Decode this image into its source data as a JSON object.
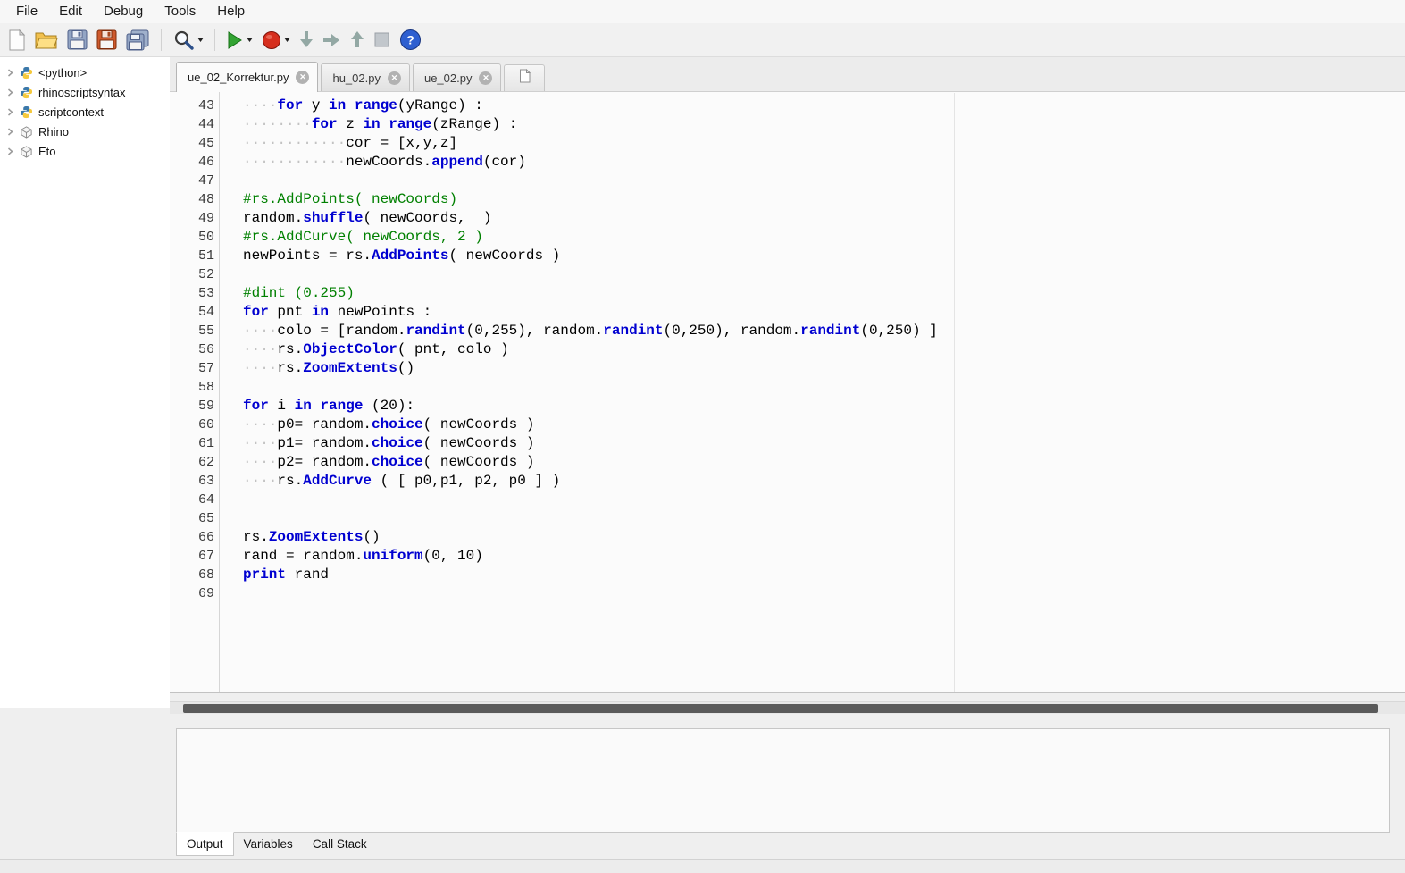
{
  "menu": {
    "items": [
      {
        "label": "File"
      },
      {
        "label": "Edit"
      },
      {
        "label": "Debug"
      },
      {
        "label": "Tools"
      },
      {
        "label": "Help"
      }
    ]
  },
  "toolbar": {
    "buttons": [
      {
        "name": "new-file",
        "icon": "new-file"
      },
      {
        "name": "open-file",
        "icon": "open-folder"
      },
      {
        "name": "save-file",
        "icon": "floppy"
      },
      {
        "name": "save-as",
        "icon": "floppy-red"
      },
      {
        "name": "save-all",
        "icon": "floppy-all"
      },
      {
        "name": "separator"
      },
      {
        "name": "search",
        "icon": "magnifier",
        "dropdown": true
      },
      {
        "name": "separator"
      },
      {
        "name": "run-script",
        "icon": "play",
        "dropdown": true
      },
      {
        "name": "stop-script",
        "icon": "record",
        "dropdown": true
      },
      {
        "name": "step-into",
        "icon": "arrow-down"
      },
      {
        "name": "step-over",
        "icon": "arrow-right"
      },
      {
        "name": "step-out",
        "icon": "arrow-up"
      },
      {
        "name": "pause",
        "icon": "square"
      },
      {
        "name": "help",
        "icon": "help"
      }
    ]
  },
  "sidebar": {
    "items": [
      {
        "label": "<python>",
        "icon": "python"
      },
      {
        "label": "rhinoscriptsyntax",
        "icon": "python"
      },
      {
        "label": "scriptcontext",
        "icon": "python"
      },
      {
        "label": "Rhino",
        "icon": "box"
      },
      {
        "label": "Eto",
        "icon": "box"
      }
    ]
  },
  "tabs": {
    "items": [
      {
        "label": "ue_02_Korrektur.py",
        "active": true,
        "closable": true
      },
      {
        "label": "hu_02.py",
        "active": false,
        "closable": true
      },
      {
        "label": "ue_02.py",
        "active": false,
        "closable": true
      }
    ]
  },
  "editor": {
    "syntax_colors": {
      "keyword": "#0000d0",
      "comment": "#008000",
      "whitespace_dots": "#c2c2c2",
      "text": "#000000"
    },
    "lines": [
      {
        "n": "43",
        "s": [
          [
            "ws",
            "····"
          ],
          [
            "kw",
            "for"
          ],
          [
            "tx",
            " y "
          ],
          [
            "kw",
            "in"
          ],
          [
            "tx",
            " "
          ],
          [
            "kw",
            "range"
          ],
          [
            "tx",
            "(yRange) :"
          ]
        ]
      },
      {
        "n": "44",
        "s": [
          [
            "ws",
            "········"
          ],
          [
            "kw",
            "for"
          ],
          [
            "tx",
            " z "
          ],
          [
            "kw",
            "in"
          ],
          [
            "tx",
            " "
          ],
          [
            "kw",
            "range"
          ],
          [
            "tx",
            "(zRange) :"
          ]
        ]
      },
      {
        "n": "45",
        "s": [
          [
            "ws",
            "············"
          ],
          [
            "tx",
            "cor = [x,y,z]"
          ]
        ]
      },
      {
        "n": "46",
        "s": [
          [
            "ws",
            "············"
          ],
          [
            "tx",
            "newCoords."
          ],
          [
            "kw",
            "append"
          ],
          [
            "tx",
            "(cor)"
          ]
        ]
      },
      {
        "n": "47",
        "s": []
      },
      {
        "n": "48",
        "s": [
          [
            "cm",
            "#rs.AddPoints( newCoords)"
          ]
        ]
      },
      {
        "n": "49",
        "s": [
          [
            "tx",
            "random."
          ],
          [
            "kw",
            "shuffle"
          ],
          [
            "tx",
            "( newCoords,  )"
          ]
        ]
      },
      {
        "n": "50",
        "s": [
          [
            "cm",
            "#rs.AddCurve( newCoords, 2 )"
          ]
        ]
      },
      {
        "n": "51",
        "s": [
          [
            "tx",
            "newPoints = rs."
          ],
          [
            "kw",
            "AddPoints"
          ],
          [
            "tx",
            "( newCoords )"
          ]
        ]
      },
      {
        "n": "52",
        "s": []
      },
      {
        "n": "53",
        "s": [
          [
            "cm",
            "#dint (0.255)"
          ]
        ]
      },
      {
        "n": "54",
        "s": [
          [
            "kw",
            "for"
          ],
          [
            "tx",
            " pnt "
          ],
          [
            "kw",
            "in"
          ],
          [
            "tx",
            " newPoints :"
          ]
        ]
      },
      {
        "n": "55",
        "s": [
          [
            "ws",
            "····"
          ],
          [
            "tx",
            "colo = [random."
          ],
          [
            "kw",
            "randint"
          ],
          [
            "tx",
            "(0,255), random."
          ],
          [
            "kw",
            "randint"
          ],
          [
            "tx",
            "(0,250), random."
          ],
          [
            "kw",
            "randint"
          ],
          [
            "tx",
            "(0,250) ]"
          ]
        ]
      },
      {
        "n": "56",
        "s": [
          [
            "ws",
            "····"
          ],
          [
            "tx",
            "rs."
          ],
          [
            "kw",
            "ObjectColor"
          ],
          [
            "tx",
            "( pnt, colo )"
          ]
        ]
      },
      {
        "n": "57",
        "s": [
          [
            "ws",
            "····"
          ],
          [
            "tx",
            "rs."
          ],
          [
            "kw",
            "ZoomExtents"
          ],
          [
            "tx",
            "()"
          ]
        ]
      },
      {
        "n": "58",
        "s": []
      },
      {
        "n": "59",
        "s": [
          [
            "kw",
            "for"
          ],
          [
            "tx",
            " i "
          ],
          [
            "kw",
            "in"
          ],
          [
            "tx",
            " "
          ],
          [
            "kw",
            "range"
          ],
          [
            "tx",
            " (20):"
          ]
        ]
      },
      {
        "n": "60",
        "s": [
          [
            "ws",
            "····"
          ],
          [
            "tx",
            "p0= random."
          ],
          [
            "kw",
            "choice"
          ],
          [
            "tx",
            "( newCoords )"
          ]
        ]
      },
      {
        "n": "61",
        "s": [
          [
            "ws",
            "····"
          ],
          [
            "tx",
            "p1= random."
          ],
          [
            "kw",
            "choice"
          ],
          [
            "tx",
            "( newCoords )"
          ]
        ]
      },
      {
        "n": "62",
        "s": [
          [
            "ws",
            "····"
          ],
          [
            "tx",
            "p2= random."
          ],
          [
            "kw",
            "choice"
          ],
          [
            "tx",
            "( newCoords )"
          ]
        ]
      },
      {
        "n": "63",
        "s": [
          [
            "ws",
            "····"
          ],
          [
            "tx",
            "rs."
          ],
          [
            "kw",
            "AddCurve"
          ],
          [
            "tx",
            " ( [ p0,p1, p2, p0 ] )"
          ]
        ]
      },
      {
        "n": "64",
        "s": []
      },
      {
        "n": "65",
        "s": []
      },
      {
        "n": "66",
        "s": [
          [
            "tx",
            "rs."
          ],
          [
            "kw",
            "ZoomExtents"
          ],
          [
            "tx",
            "()"
          ]
        ]
      },
      {
        "n": "67",
        "s": [
          [
            "tx",
            "rand = random."
          ],
          [
            "kw",
            "uniform"
          ],
          [
            "tx",
            "(0, 10)"
          ]
        ]
      },
      {
        "n": "68",
        "s": [
          [
            "kw",
            "print"
          ],
          [
            "tx",
            " rand"
          ]
        ]
      },
      {
        "n": "69",
        "s": []
      }
    ]
  },
  "bottom_panel": {
    "tabs": [
      {
        "label": "Output",
        "active": true
      },
      {
        "label": "Variables",
        "active": false
      },
      {
        "label": "Call Stack",
        "active": false
      }
    ]
  }
}
